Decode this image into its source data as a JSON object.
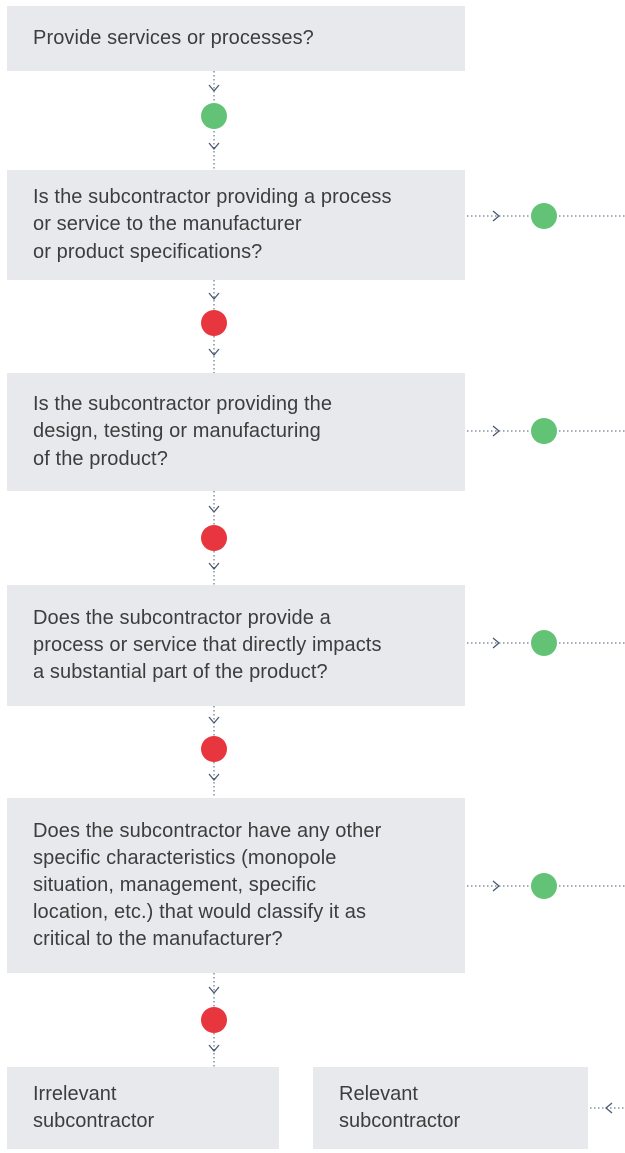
{
  "questions": [
    {
      "id": "q1",
      "text": "Provide services or processes?"
    },
    {
      "id": "q2",
      "text": "Is the subcontractor providing a process\nor service to the manufacturer\nor product specifications?"
    },
    {
      "id": "q3",
      "text": "Is the subcontractor providing the\ndesign, testing or manufacturing\nof the product?"
    },
    {
      "id": "q4",
      "text": "Does the subcontractor provide a\nprocess or service that directly impacts\na substantial part of the product?"
    },
    {
      "id": "q5",
      "text": "Does the subcontractor have any other\nspecific characteristics (monopole\nsituation, management, specific\nlocation, etc.) that would classify it as\ncritical to the manufacturer?"
    }
  ],
  "outcomes": {
    "irrelevant": "Irrelevant\nsubcontractor",
    "relevant": "Relevant\nsubcontractor"
  },
  "colors": {
    "box_fill": "#e8e9ed",
    "yes_dot": "#62c276",
    "no_dot": "#e8363f",
    "connector": "#4a5a70"
  },
  "down_connector_answers": [
    "yes",
    "no",
    "no",
    "no",
    "no"
  ],
  "side_connector_answers": [
    "yes",
    "yes",
    "yes",
    "yes"
  ]
}
